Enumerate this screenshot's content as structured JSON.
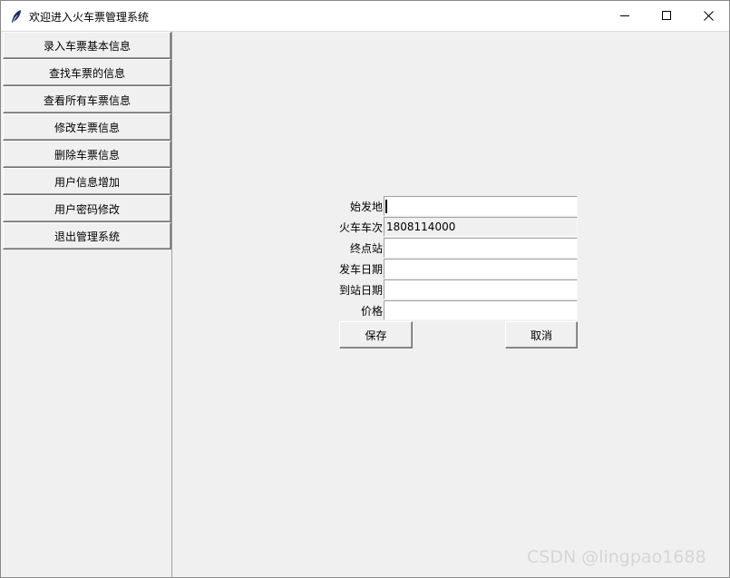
{
  "window": {
    "title": "欢迎进入火车票管理系统",
    "icon": "feather-icon",
    "controls": [
      "minimize-icon",
      "maximize-icon",
      "close-icon"
    ]
  },
  "sidebar": {
    "items": [
      {
        "label": "录入车票基本信息"
      },
      {
        "label": "查找车票的信息"
      },
      {
        "label": "查看所有车票信息"
      },
      {
        "label": "修改车票信息"
      },
      {
        "label": "删除车票信息"
      },
      {
        "label": "用户信息增加"
      },
      {
        "label": "用户密码修改"
      },
      {
        "label": "退出管理系统"
      }
    ]
  },
  "form": {
    "fields": [
      {
        "label": "始发地",
        "value": "",
        "readonly": false
      },
      {
        "label": "火车车次",
        "value": "1808114000",
        "readonly": true
      },
      {
        "label": "终点站",
        "value": "",
        "readonly": false
      },
      {
        "label": "发车日期",
        "value": "",
        "readonly": false
      },
      {
        "label": "到站日期",
        "value": "",
        "readonly": false
      },
      {
        "label": "价格",
        "value": "",
        "readonly": false
      }
    ],
    "save_label": "保存",
    "cancel_label": "取消"
  },
  "watermark": "CSDN @lingpao1688",
  "colors": {
    "background": "#f0f0f0",
    "titlebar": "#ffffff",
    "input_bg": "#ffffff"
  }
}
